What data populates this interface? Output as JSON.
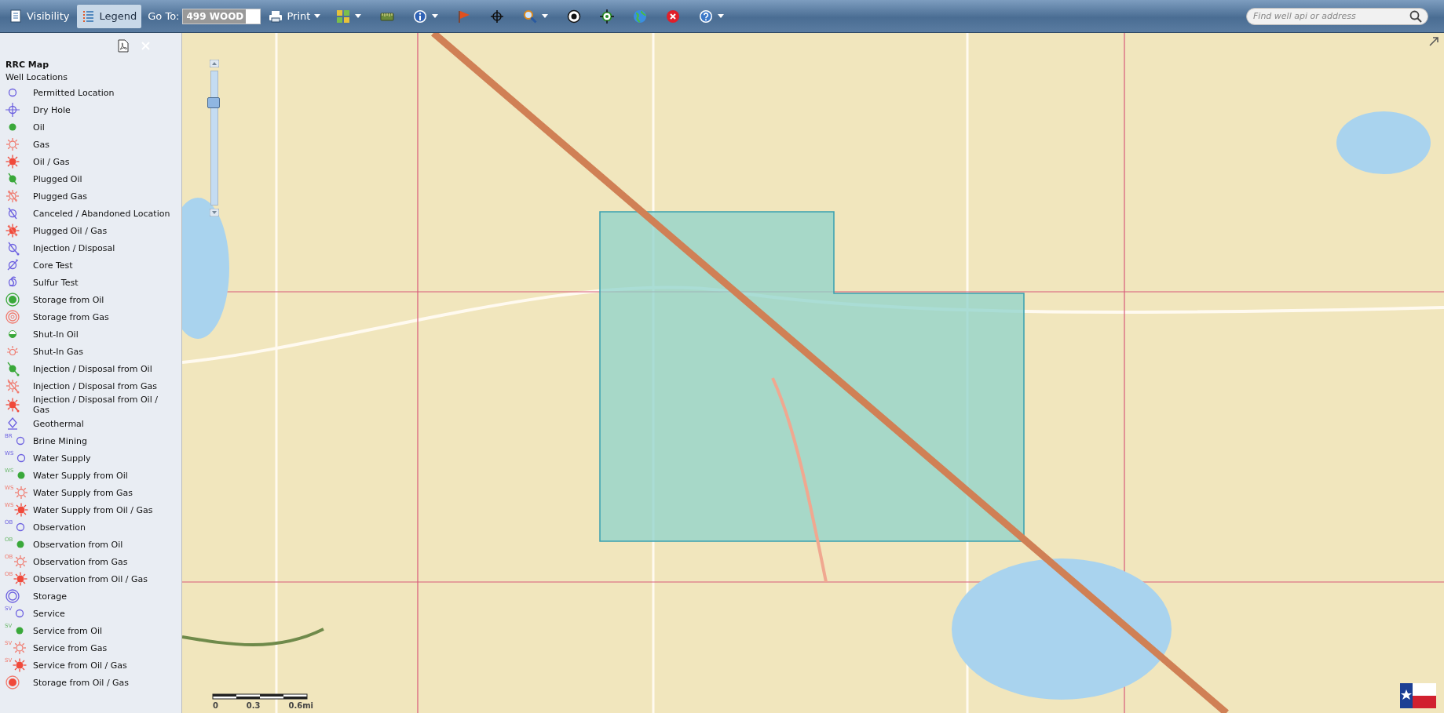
{
  "toolbar": {
    "view_buttons": [
      {
        "label": "Visibility",
        "selected": false
      },
      {
        "label": "Legend",
        "selected": true
      }
    ],
    "goto": {
      "label": "Go To:",
      "value": "499 WOOD"
    },
    "print": {
      "label": "Print",
      "caret": true
    },
    "tools": [
      {
        "caret": true
      },
      {
        "caret": false
      },
      {
        "caret": true
      },
      {
        "caret": false
      },
      {
        "caret": false
      },
      {
        "caret": true
      },
      {
        "caret": false
      },
      {
        "caret": false
      },
      {
        "caret": false
      },
      {
        "caret": false
      },
      {
        "caret": true
      }
    ],
    "search": {
      "placeholder": "Find well api or address"
    }
  },
  "legend": {
    "title": "RRC Map",
    "group": "Well Locations",
    "items": [
      {
        "label": "Permitted Location",
        "kind": "permitted"
      },
      {
        "label": "Dry Hole",
        "kind": "dry"
      },
      {
        "label": "Oil",
        "kind": "oil"
      },
      {
        "label": "Gas",
        "kind": "gas"
      },
      {
        "label": "Oil / Gas",
        "kind": "oilgas"
      },
      {
        "label": "Plugged Oil",
        "kind": "plugged-oil"
      },
      {
        "label": "Plugged Gas",
        "kind": "plugged-gas"
      },
      {
        "label": "Canceled / Abandoned Location",
        "kind": "canceled"
      },
      {
        "label": "Plugged Oil / Gas",
        "kind": "plugged-oilgas"
      },
      {
        "label": "Injection / Disposal",
        "kind": "injection"
      },
      {
        "label": "Core Test",
        "kind": "core"
      },
      {
        "label": "Sulfur Test",
        "kind": "sulfur"
      },
      {
        "label": "Storage from Oil",
        "kind": "storage-oil"
      },
      {
        "label": "Storage from Gas",
        "kind": "storage-gas"
      },
      {
        "label": "Shut-In Oil",
        "kind": "shutin-oil"
      },
      {
        "label": "Shut-In Gas",
        "kind": "shutin-gas"
      },
      {
        "label": "Injection / Disposal from Oil",
        "kind": "injection-oil"
      },
      {
        "label": "Injection / Disposal from Gas",
        "kind": "injection-gas"
      },
      {
        "label": "Injection / Disposal from Oil / Gas",
        "kind": "injection-oilgas"
      },
      {
        "label": "Geothermal",
        "kind": "geothermal"
      },
      {
        "label": "Brine Mining",
        "kind": "permitted",
        "prefix": "BR"
      },
      {
        "label": "Water Supply",
        "kind": "permitted",
        "prefix": "WS"
      },
      {
        "label": "Water Supply from Oil",
        "kind": "oil",
        "prefix": "WS"
      },
      {
        "label": "Water Supply from Gas",
        "kind": "gas",
        "prefix": "WS"
      },
      {
        "label": "Water Supply from Oil / Gas",
        "kind": "oilgas",
        "prefix": "WS"
      },
      {
        "label": "Observation",
        "kind": "permitted",
        "prefix": "OB"
      },
      {
        "label": "Observation from Oil",
        "kind": "oil",
        "prefix": "OB"
      },
      {
        "label": "Observation from Gas",
        "kind": "gas",
        "prefix": "OB"
      },
      {
        "label": "Observation from Oil / Gas",
        "kind": "oilgas",
        "prefix": "OB"
      },
      {
        "label": "Storage",
        "kind": "storage"
      },
      {
        "label": "Service",
        "kind": "permitted",
        "prefix": "SV"
      },
      {
        "label": "Service from Oil",
        "kind": "oil",
        "prefix": "SV"
      },
      {
        "label": "Service from Gas",
        "kind": "gas",
        "prefix": "SV"
      },
      {
        "label": "Service from Oil / Gas",
        "kind": "oilgas",
        "prefix": "SV"
      },
      {
        "label": "Storage from Oil / Gas",
        "kind": "storage-oilgas"
      }
    ]
  },
  "map": {
    "kind": "picture",
    "zoom_slider": {
      "level": 0.78
    },
    "scale_bar": {
      "labels": [
        "0",
        "0.3",
        "0.6mi"
      ]
    }
  }
}
